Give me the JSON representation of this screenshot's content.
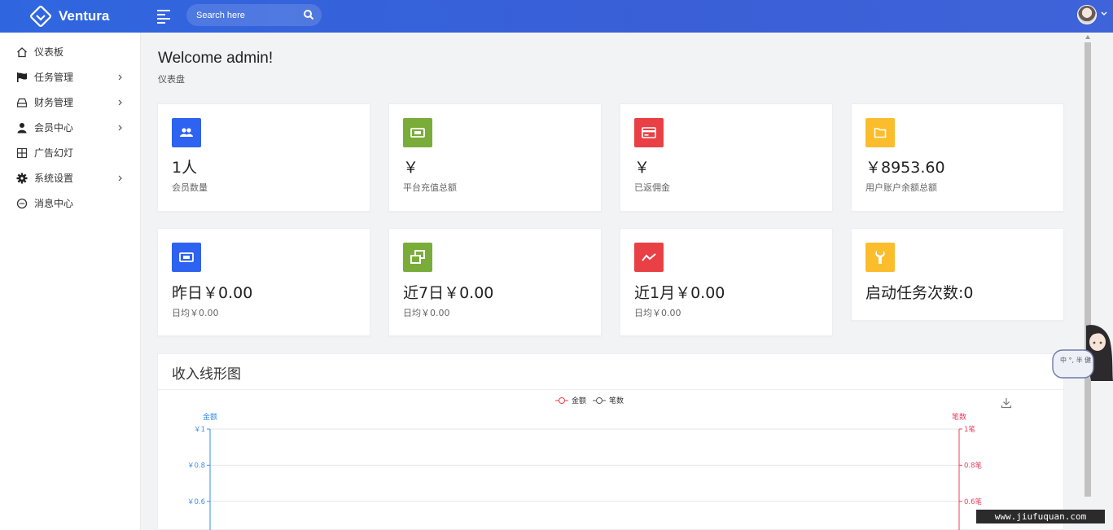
{
  "header": {
    "brand": "Ventura",
    "search_placeholder": "Search here"
  },
  "sidebar": {
    "items": [
      {
        "label": "仪表板",
        "icon": "home-icon",
        "has_children": false
      },
      {
        "label": "任务管理",
        "icon": "flag-icon",
        "has_children": true
      },
      {
        "label": "财务管理",
        "icon": "drive-icon",
        "has_children": true
      },
      {
        "label": "会员中心",
        "icon": "user-icon",
        "has_children": true
      },
      {
        "label": "广告幻灯",
        "icon": "grid-icon",
        "has_children": false
      },
      {
        "label": "系统设置",
        "icon": "gear-icon",
        "has_children": true
      },
      {
        "label": "消息中心",
        "icon": "chat-icon",
        "has_children": false
      }
    ]
  },
  "page": {
    "welcome": "Welcome admin!",
    "breadcrumb": "仪表盘"
  },
  "stats": [
    {
      "value": "1人",
      "label": "会员数量",
      "icon": "users-icon",
      "color": "#2e62f0"
    },
    {
      "value": "￥",
      "label": "平台充值总额",
      "icon": "money-icon",
      "color": "#7aac3a"
    },
    {
      "value": "￥",
      "label": "已返佣金",
      "icon": "card-icon",
      "color": "#e84045"
    },
    {
      "value": "￥8953.60",
      "label": "用户账户余额总额",
      "icon": "folder-icon",
      "color": "#fbbd2c"
    },
    {
      "value": "昨日￥0.00",
      "label": "日均￥0.00",
      "icon": "money-icon",
      "color": "#2e62f0"
    },
    {
      "value": "近7日￥0.00",
      "label": "日均￥0.00",
      "icon": "windows-icon",
      "color": "#7aac3a"
    },
    {
      "value": "近1月￥0.00",
      "label": "日均￥0.00",
      "icon": "trend-icon",
      "color": "#e84045"
    },
    {
      "value": "启动任务次数:0",
      "label": "",
      "icon": "wrench-icon",
      "color": "#fbbd2c"
    }
  ],
  "chart_data": {
    "type": "line",
    "title": "收入线形图",
    "series": [
      {
        "name": "金额",
        "color": "#e84045",
        "values": []
      },
      {
        "name": "笔数",
        "color": "#555555",
        "values": []
      }
    ],
    "y_left": {
      "label": "金额",
      "ticks": [
        "￥1",
        "￥0.8",
        "￥0.6"
      ],
      "values": [
        1,
        0.8,
        0.6
      ],
      "color": "#3a8ee6"
    },
    "y_right": {
      "label": "笔数",
      "ticks": [
        "1笔",
        "0.8笔",
        "0.6笔"
      ],
      "values": [
        1,
        0.8,
        0.6
      ],
      "color": "#e8405e"
    },
    "ylim": [
      0,
      1
    ],
    "grid": true,
    "legend": "top-center"
  },
  "overlay": {
    "mascot_text": "中 °, 半 健",
    "watermark": "www.jiufuquan.com"
  },
  "colors": {
    "accent": "#2f66e0"
  }
}
